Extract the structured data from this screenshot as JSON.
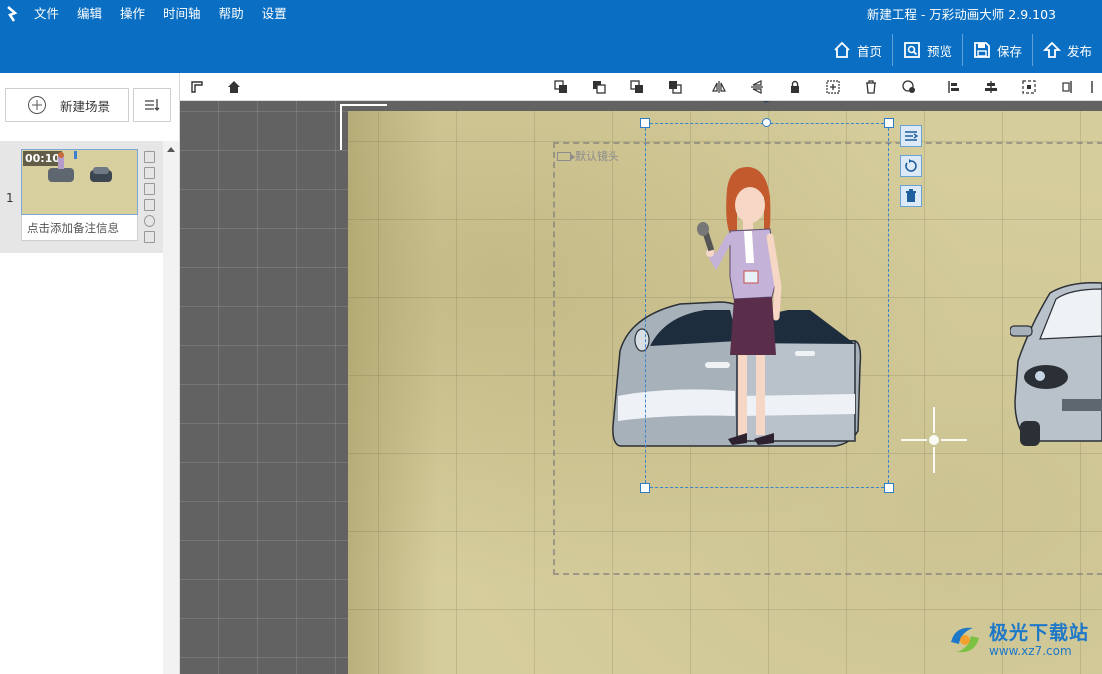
{
  "menu": {
    "items": [
      "文件",
      "编辑",
      "操作",
      "时间轴",
      "帮助",
      "设置"
    ]
  },
  "window": {
    "title": "新建工程 - 万彩动画大师 2.9.103"
  },
  "actions": {
    "home": "首页",
    "preview": "预览",
    "save": "保存",
    "publish": "发布"
  },
  "scenes": {
    "new_scene_label": "新建场景",
    "items": [
      {
        "number": "1",
        "duration": "00:10",
        "note_placeholder": "点击添加备注信息"
      }
    ]
  },
  "canvas": {
    "camera_label": "默认镜头"
  },
  "colors": {
    "titlebar": "#0a6fc2",
    "selection": "#2d7cc4",
    "canvas_bg": "#626262",
    "paper": "#d6cd9d"
  },
  "watermark": {
    "title": "极光下载站",
    "url": "www.xz7.com"
  }
}
